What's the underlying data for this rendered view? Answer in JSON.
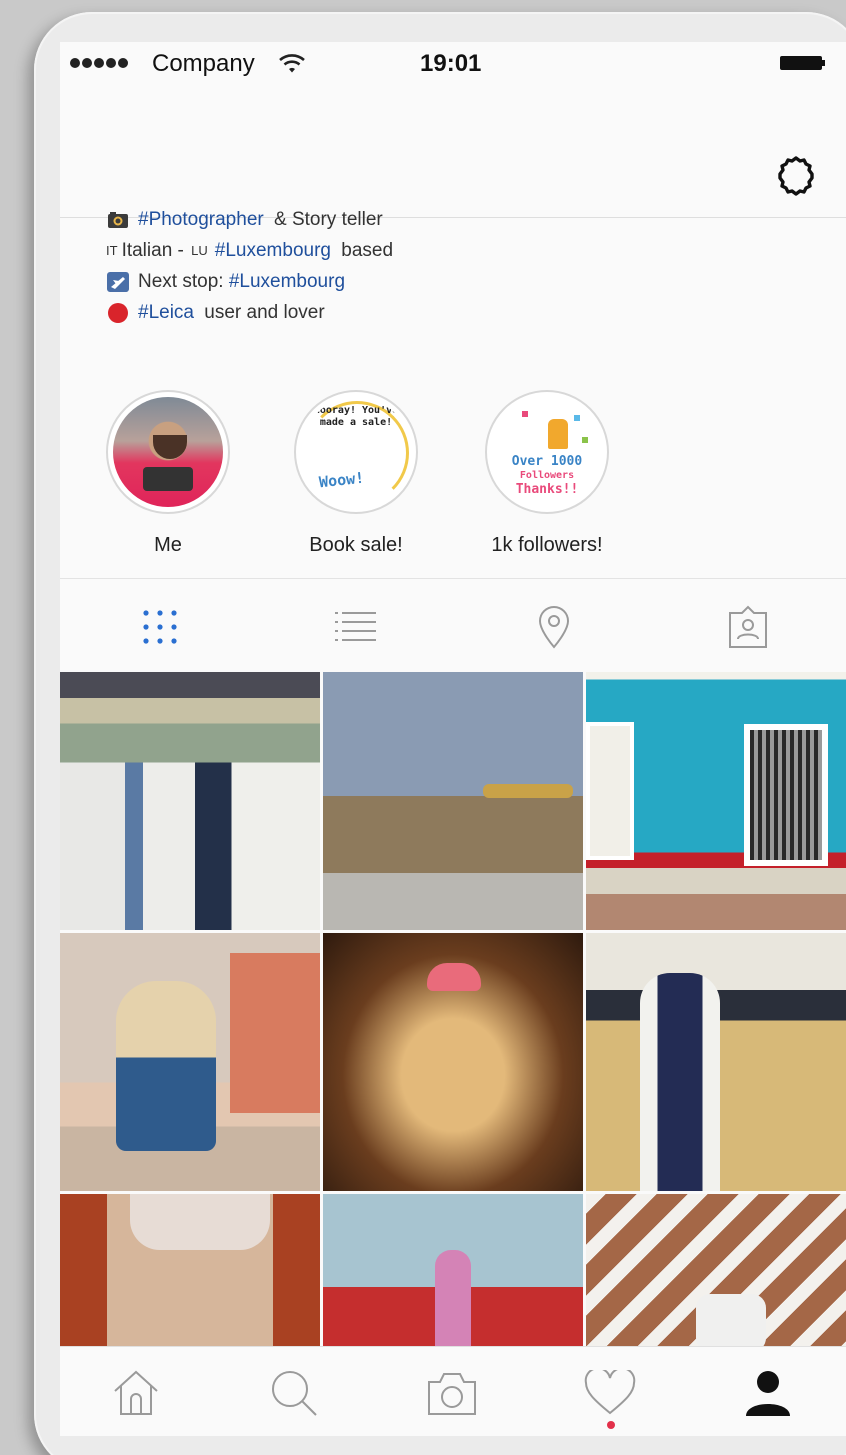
{
  "status_bar": {
    "carrier": "Company",
    "time": "19:01"
  },
  "nav": {
    "settings_icon": "gear-icon"
  },
  "bio": {
    "lines": [
      {
        "icon": "camera-emoji-icon",
        "hashtag": "#Photographer",
        "text": " & Story teller"
      },
      {
        "flag_prefix": "IT",
        "text_before": "Italian - ",
        "flag_mid": "LU",
        "hashtag": "#Luxembourg",
        "text": " based"
      },
      {
        "icon": "airplane-emoji-icon",
        "text_before": "Next stop: ",
        "hashtag": "#Luxembourg"
      },
      {
        "icon": "red-circle-icon",
        "hashtag": "#Leica",
        "text": " user and lover"
      }
    ]
  },
  "highlights": [
    {
      "label": "Me"
    },
    {
      "label": "Book sale!",
      "cover_text": "Hooray! You've made a sale!",
      "cover_accent": "Woow!"
    },
    {
      "label": "1k followers!",
      "cover_line1": "Over 1000",
      "cover_line2": "Followers",
      "cover_line3": "Thanks!!"
    }
  ],
  "tabs": [
    {
      "icon": "grid-icon",
      "active": true
    },
    {
      "icon": "list-icon",
      "active": false
    },
    {
      "icon": "location-pin-icon",
      "active": false
    },
    {
      "icon": "tagged-photos-icon",
      "active": false
    }
  ],
  "grid": {
    "photos": [
      "photo-market-men",
      "photo-wall-sleeping-man",
      "photo-blue-house-walker",
      "photo-man-straw-hat",
      "photo-old-man-red-cap",
      "photo-man-blue-vest",
      "photo-man-turban-closeup",
      "photo-girl-red-wall",
      "photo-man-striped-shadows"
    ]
  },
  "tabbar": {
    "items": [
      "home-icon",
      "search-icon",
      "camera-icon",
      "heart-icon",
      "profile-icon"
    ],
    "active": "profile-icon",
    "notification_dot_color": "#e2304a"
  },
  "colors": {
    "hashtag": "#1f4f9c",
    "active_tab": "#2a6fd1",
    "inactive_icon": "#9a9a9a"
  }
}
